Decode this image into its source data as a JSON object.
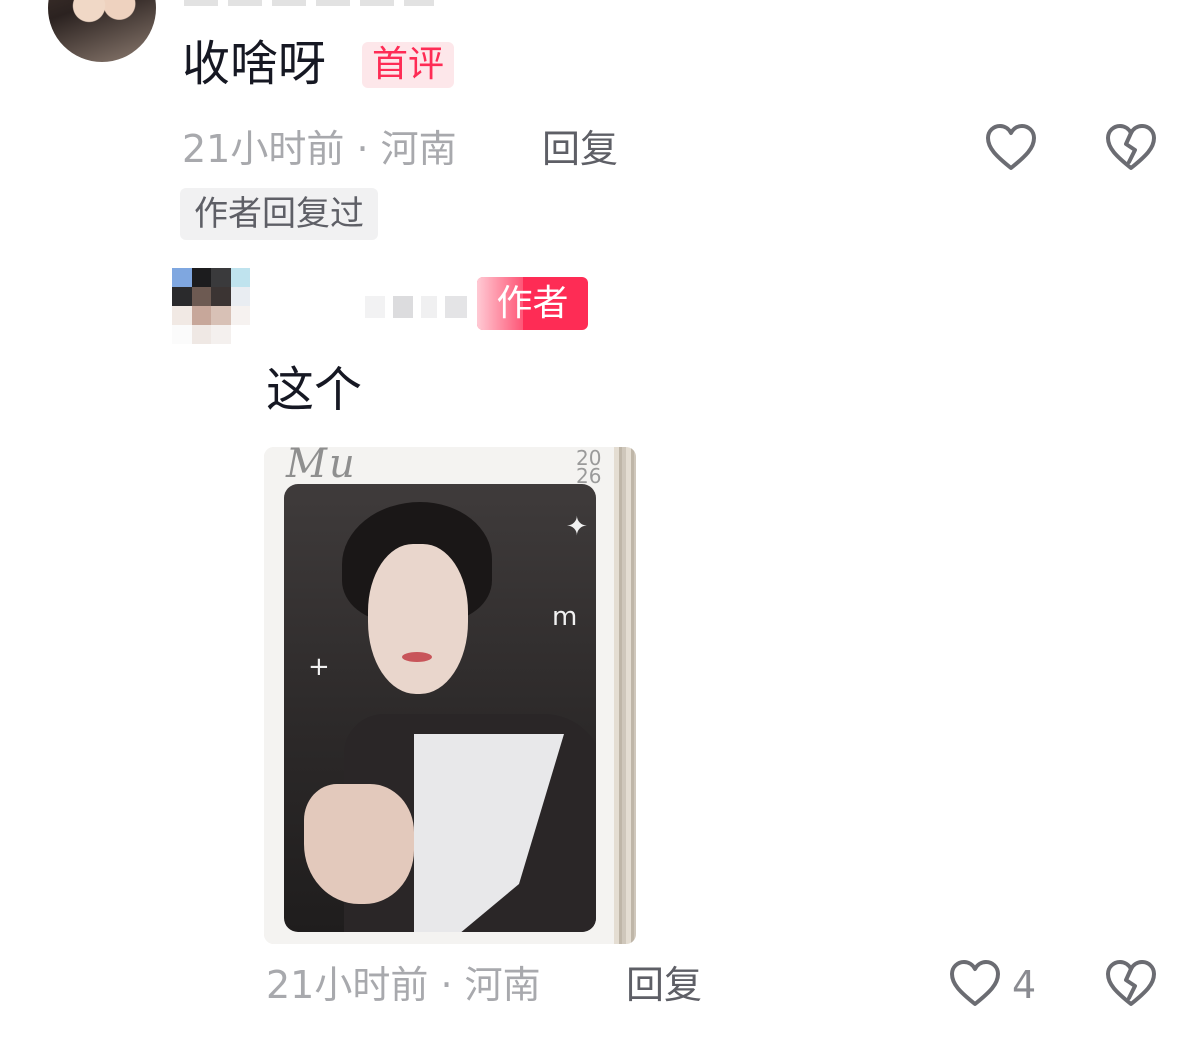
{
  "comment": {
    "text": "收啥呀",
    "badge": "首评",
    "time": "21小时前",
    "location": "河南",
    "reply_label": "回复",
    "author_replied_tag": "作者回复过"
  },
  "reply": {
    "author_badge": "作者",
    "text": "这个",
    "time": "21小时前",
    "location": "河南",
    "reply_label": "回复",
    "like_count": "4",
    "photo": {
      "brand_text": "Mu",
      "year_text": "20\n26"
    }
  },
  "colors": {
    "accent": "#fe2c55",
    "meta_text": "#a8a9ad",
    "action_text": "#5e5f66",
    "tag_bg": "#f1f1f2"
  },
  "icons": {
    "like": "heart-outline-icon",
    "dislike": "broken-heart-icon"
  }
}
